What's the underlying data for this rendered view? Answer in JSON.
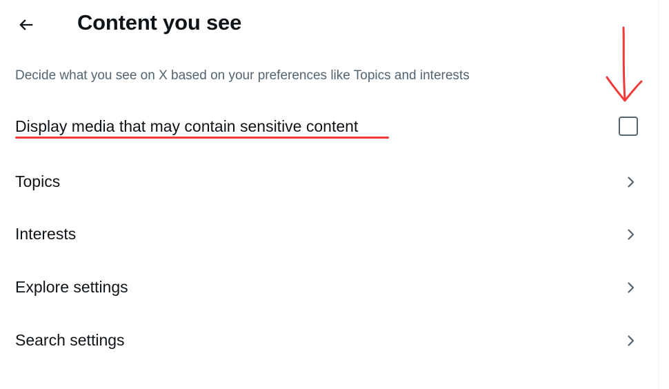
{
  "header": {
    "back_icon": "arrow-left-icon",
    "title": "Content you see"
  },
  "description": "Decide what you see on X based on your preferences like Topics and interests",
  "sensitive_media": {
    "label": "Display media that may contain sensitive content",
    "checked": false
  },
  "nav_items": [
    {
      "label": "Topics",
      "icon": "chevron-right-icon"
    },
    {
      "label": "Interests",
      "icon": "chevron-right-icon"
    },
    {
      "label": "Explore settings",
      "icon": "chevron-right-icon"
    },
    {
      "label": "Search settings",
      "icon": "chevron-right-icon"
    }
  ],
  "colors": {
    "text_primary": "#0f1419",
    "text_secondary": "#536471",
    "annotation_red": "#f03a3a"
  }
}
